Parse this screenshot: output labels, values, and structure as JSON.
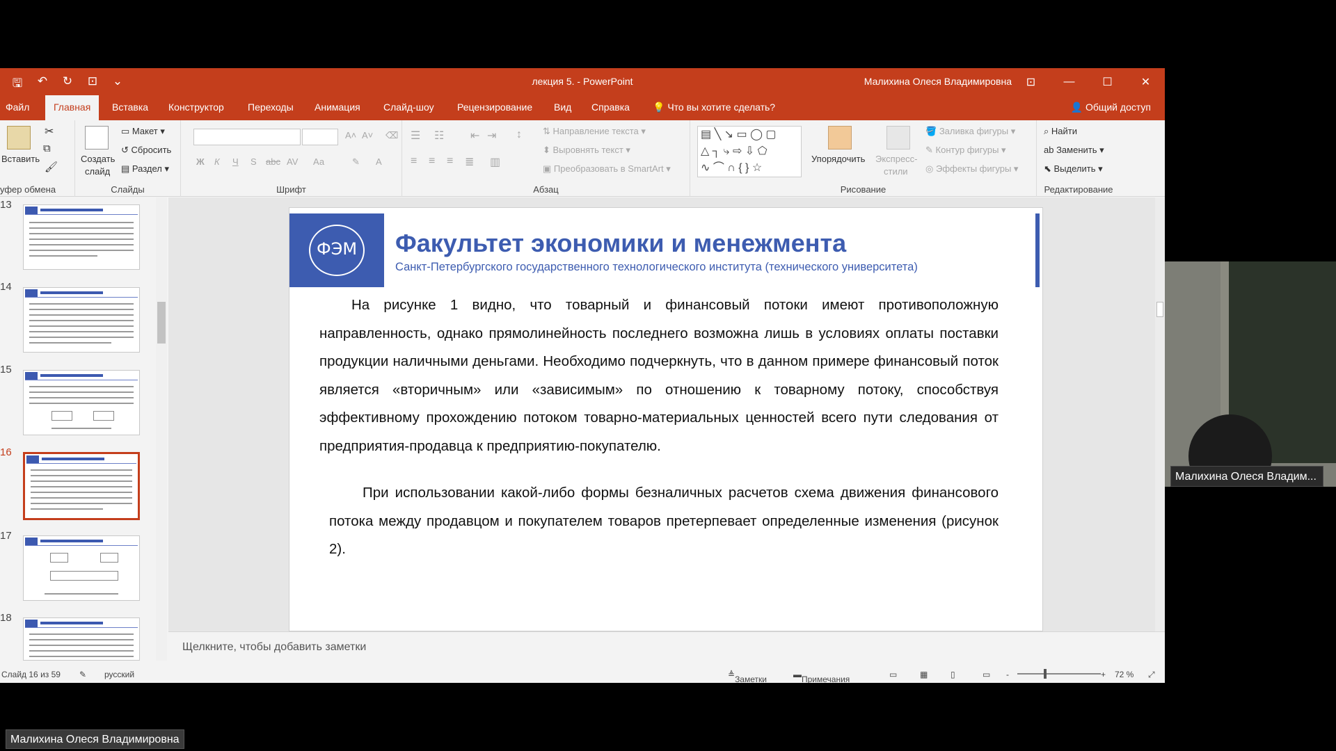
{
  "window": {
    "doc_title": "лекция 5.  -  PowerPoint",
    "user_name": "Малихина Олеся Владимировна",
    "controls": [
      "⊡",
      "—",
      "☐",
      "✕"
    ]
  },
  "tabs": [
    {
      "label": "Файл"
    },
    {
      "label": "Главная"
    },
    {
      "label": "Вставка"
    },
    {
      "label": "Конструктор"
    },
    {
      "label": "Переходы"
    },
    {
      "label": "Анимация"
    },
    {
      "label": "Слайд-шоу"
    },
    {
      "label": "Рецензирование"
    },
    {
      "label": "Вид"
    },
    {
      "label": "Справка"
    },
    {
      "label": "Что вы хотите сделать?"
    }
  ],
  "share_label": "Общий доступ",
  "ribbon": {
    "clipboard": {
      "paste": "Вставить",
      "label": "уфер обмена"
    },
    "slides": {
      "new_slide_1": "Создать",
      "new_slide_2": "слайд",
      "layout": "Макет",
      "reset": "Сбросить",
      "section": "Раздел",
      "label": "Слайды"
    },
    "font": {
      "bold": "Ж",
      "italic": "К",
      "underline": "Ч",
      "shadow": "S",
      "strike": "abc",
      "spacing": "AV",
      "case": "Аа",
      "color": "А",
      "label": "Шрифт"
    },
    "paragraph": {
      "text_dir": "Направление текста",
      "align_text": "Выровнять текст",
      "smartart": "Преобразовать в SmartArt",
      "label": "Абзац"
    },
    "drawing": {
      "arrange": "Упорядочить",
      "styles_1": "Экспресс-",
      "styles_2": "стили",
      "fill": "Заливка фигуры",
      "outline": "Контур фигуры",
      "effects": "Эффекты фигуры",
      "label": "Рисование"
    },
    "editing": {
      "find": "Найти",
      "replace": "Заменить",
      "select": "Выделить",
      "label": "Редактирование"
    }
  },
  "thumbnails": [
    {
      "num": "13"
    },
    {
      "num": "14"
    },
    {
      "num": "15"
    },
    {
      "num": "16",
      "selected": true
    },
    {
      "num": "17"
    },
    {
      "num": "18"
    }
  ],
  "slide": {
    "logo_text": "ФЭМ",
    "title": "Факультет экономики и менежмента",
    "subtitle": "Санкт-Петербургского государственного технологического института (технического университета)",
    "paragraph1": "На рисунке 1 видно, что товарный и финансовый потоки имеют противоположную направленность, однако прямолинейность последнего возможна лишь в условиях оплаты поставки продукции наличными деньгами. Необходимо подчеркнуть, что в данном примере финансовый поток является «вторичным» или «зависимым» по отношению к товарному потоку, способствуя эффективному прохождению потоком товарно-материальных ценностей всего пути следования от предприятия-продавца к предприятию-покупателю.",
    "paragraph2": "При использовании какой-либо формы безналичных расчетов схема движения финансового потока между продавцом и покупателем товаров претерпевает определенные изменения (рисунок 2)."
  },
  "notes_placeholder": "Щелкните, чтобы добавить заметки",
  "status": {
    "slide_info": "Слайд 16 из 59",
    "language": "русский",
    "notes": "Заметки",
    "comments": "Примечания",
    "zoom_minus": "-",
    "zoom_plus": "+",
    "zoom": "72 %"
  },
  "webcam": {
    "participant": "Малихина Олеся Владим..."
  },
  "meeting": {
    "presenter": "Малихина Олеся Владимировна"
  },
  "colors": {
    "accent": "#c43e1c",
    "slide_blue": "#3d5cb0"
  }
}
